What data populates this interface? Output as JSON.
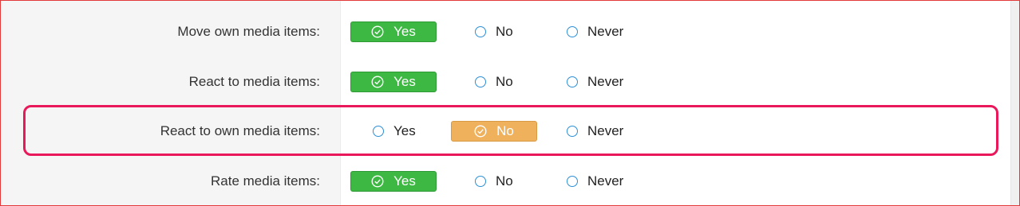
{
  "colors": {
    "yes_selected": "#3db843",
    "no_selected": "#efb15c",
    "radio": "#2d8fd6",
    "highlight": "#e8185a"
  },
  "rows": [
    {
      "label": "Move own media items:",
      "options": {
        "yes": "Yes",
        "no": "No",
        "never": "Never"
      },
      "selected": "yes"
    },
    {
      "label": "React to media items:",
      "options": {
        "yes": "Yes",
        "no": "No",
        "never": "Never"
      },
      "selected": "yes"
    },
    {
      "label": "React to own media items:",
      "options": {
        "yes": "Yes",
        "no": "No",
        "never": "Never"
      },
      "selected": "no"
    },
    {
      "label": "Rate media items:",
      "options": {
        "yes": "Yes",
        "no": "No",
        "never": "Never"
      },
      "selected": "yes"
    }
  ]
}
